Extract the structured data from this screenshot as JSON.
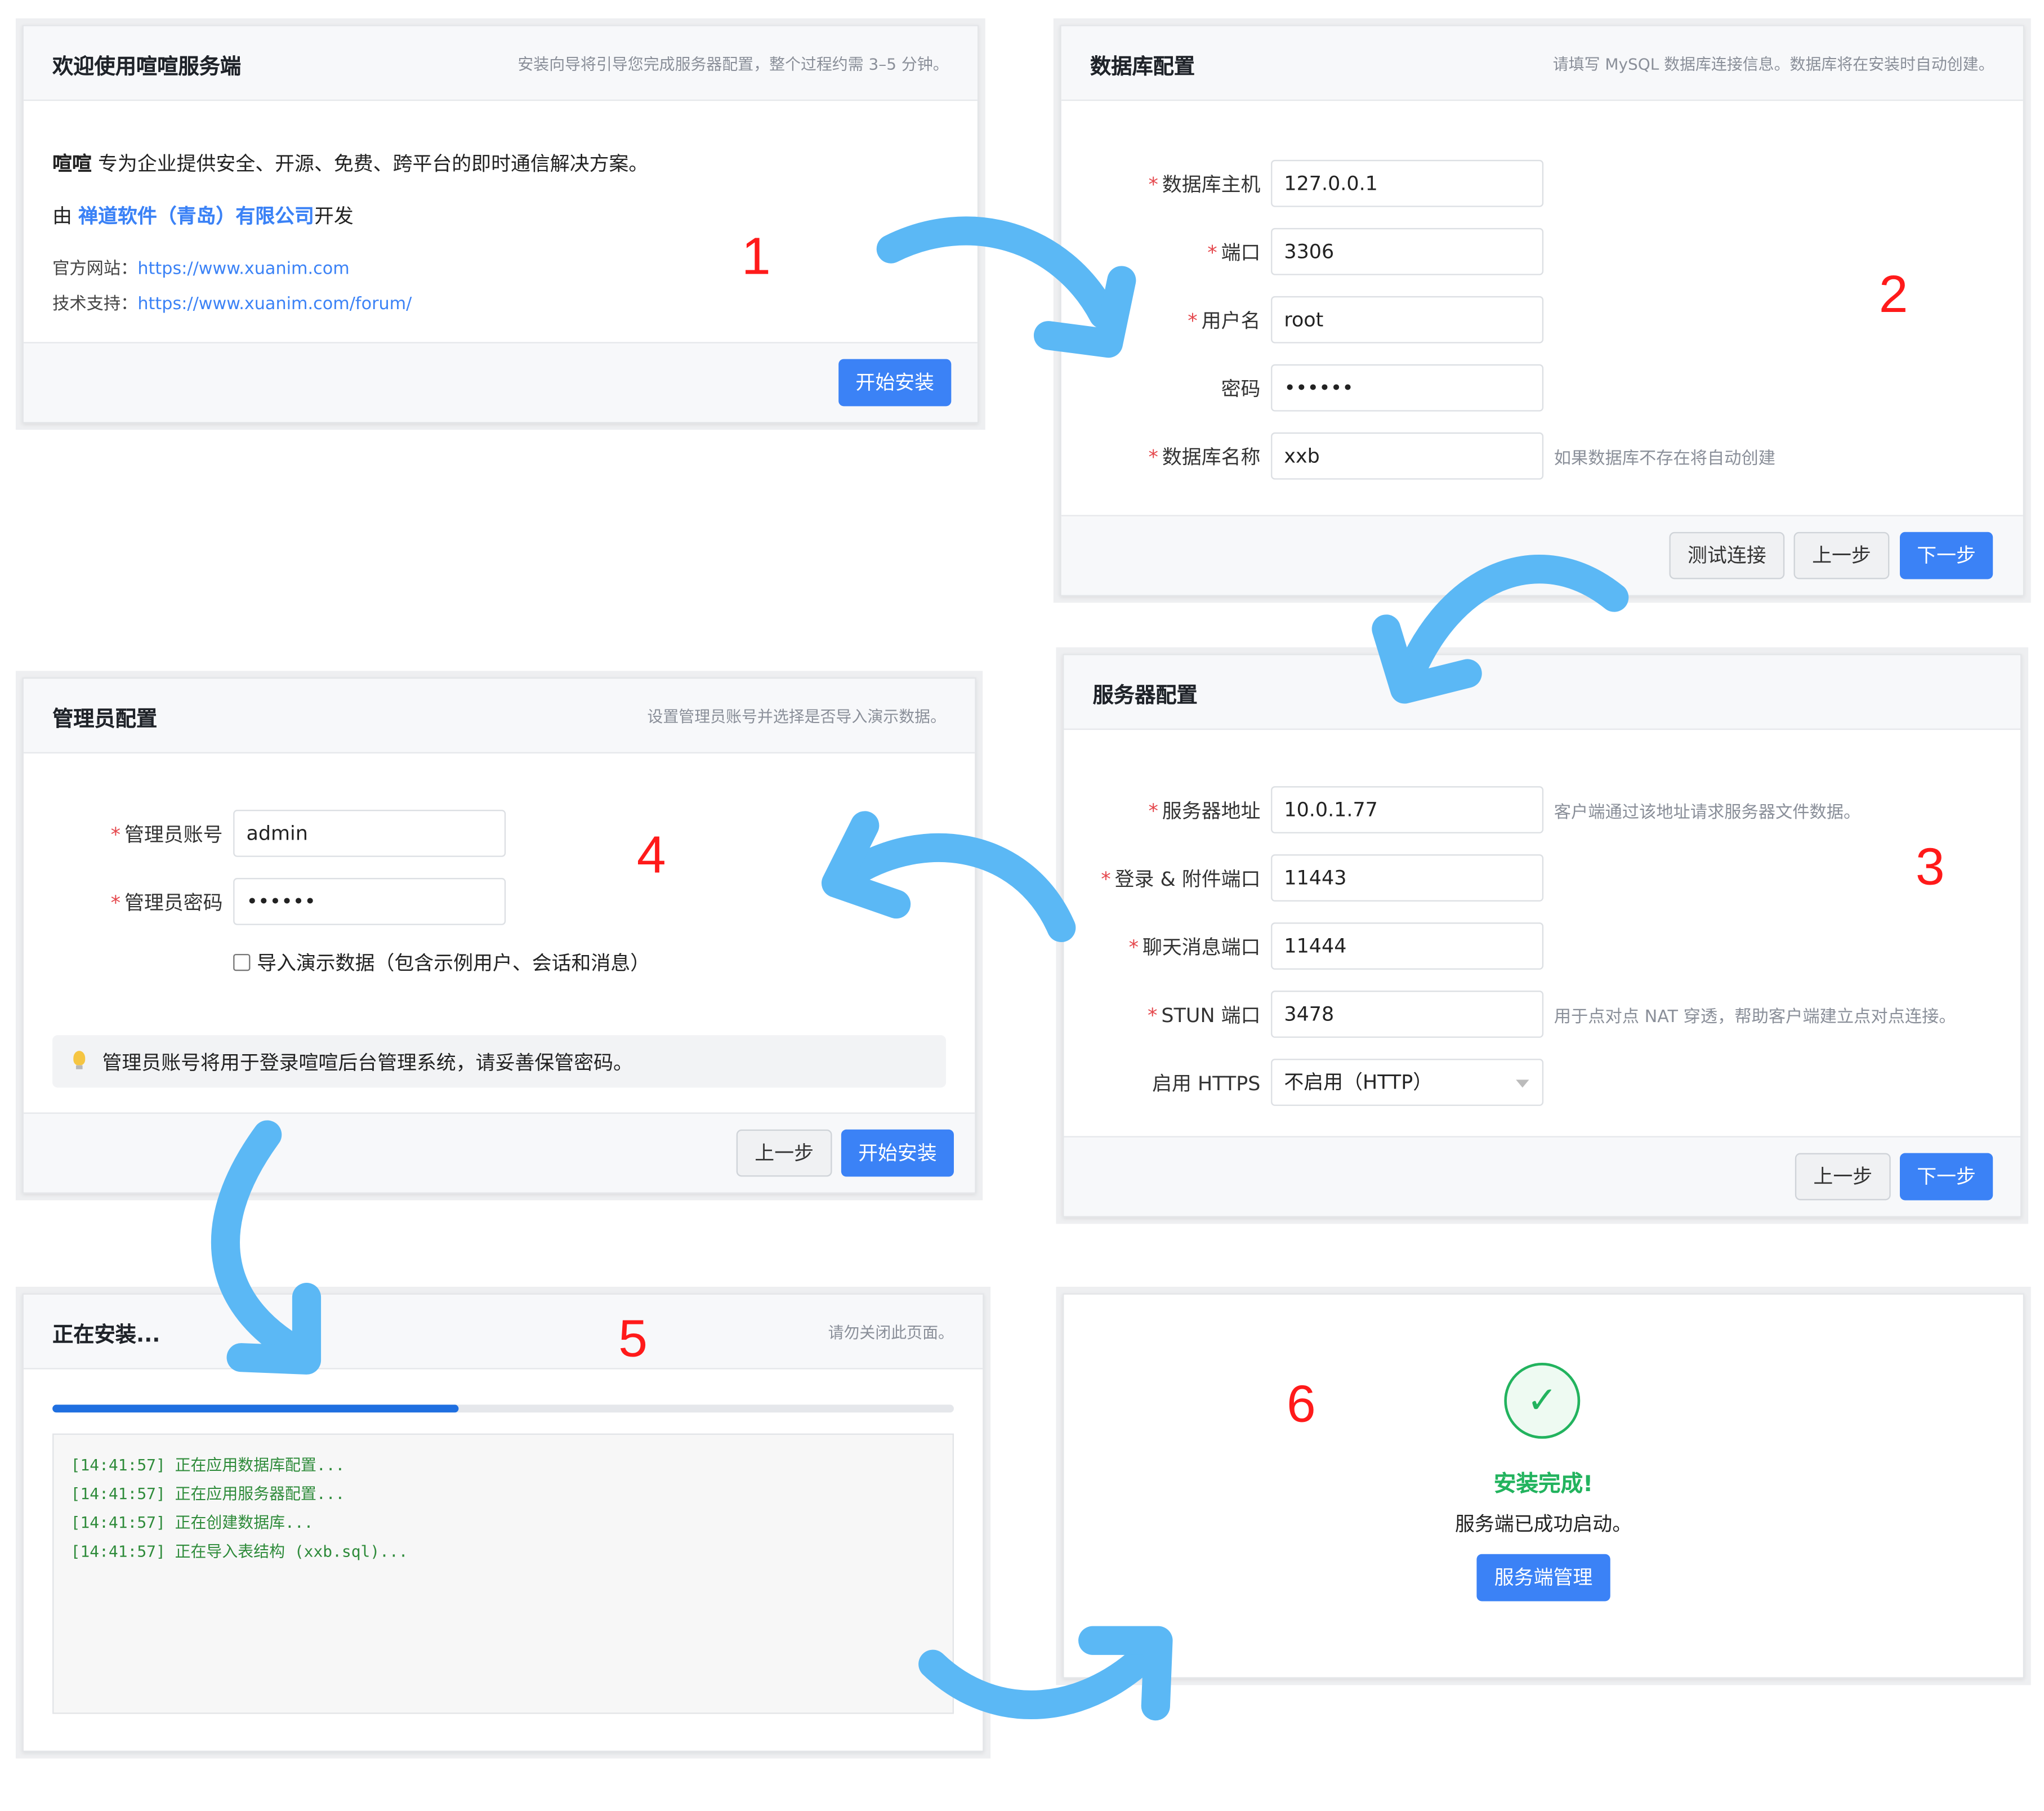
{
  "steps": {
    "welcome": {
      "number": "1",
      "title": "欢迎使用喧喧服务端",
      "desc": "安装向导将引导您完成服务器配置，整个过程约需 3–5 分钟。",
      "intro_strong": "喧喧",
      "intro_rest": " 专为企业提供安全、开源、免费、跨平台的即时通信解决方案。",
      "dev_prefix": "由 ",
      "dev_company": "禅道软件（青岛）有限公司",
      "dev_suffix": "开发",
      "site_label": "官方网站：",
      "site_url": "https://www.xuanim.com",
      "support_label": "技术支持：",
      "support_url": "https://www.xuanim.com/forum/",
      "start_button": "开始安装"
    },
    "database": {
      "number": "2",
      "title": "数据库配置",
      "desc": "请填写 MySQL 数据库连接信息。数据库将在安装时自动创建。",
      "fields": [
        {
          "label": "数据库主机",
          "required": "*",
          "value": "127.0.0.1",
          "hint": ""
        },
        {
          "label": "端口",
          "required": "*",
          "value": "3306",
          "hint": ""
        },
        {
          "label": "用户名",
          "required": "*",
          "value": "root",
          "hint": ""
        },
        {
          "label": "密码",
          "required": "",
          "value": "••••••",
          "hint": ""
        },
        {
          "label": "数据库名称",
          "required": "*",
          "value": "xxb",
          "hint": "如果数据库不存在将自动创建"
        }
      ],
      "test_button": "测试连接",
      "prev_button": "上一步",
      "next_button": "下一步"
    },
    "server": {
      "number": "3",
      "title": "服务器配置",
      "fields": [
        {
          "label": "服务器地址",
          "required": "*",
          "value": "10.0.1.77",
          "hint": "客户端通过该地址请求服务器文件数据。"
        },
        {
          "label": "登录 & 附件端口",
          "required": "*",
          "value": "11443",
          "hint": ""
        },
        {
          "label": "聊天消息端口",
          "required": "*",
          "value": "11444",
          "hint": ""
        },
        {
          "label": "STUN 端口",
          "required": "*",
          "value": "3478",
          "hint": "用于点对点 NAT 穿透，帮助客户端建立点对点连接。"
        }
      ],
      "https_label": "启用 HTTPS",
      "https_selected": "不启用（HTTP）",
      "prev_button": "上一步",
      "next_button": "下一步"
    },
    "admin": {
      "number": "4",
      "title": "管理员配置",
      "desc": "设置管理员账号并选择是否导入演示数据。",
      "fields": [
        {
          "label": "管理员账号",
          "required": "*",
          "value": "admin"
        },
        {
          "label": "管理员密码",
          "required": "*",
          "value": "••••••"
        }
      ],
      "demo_checkbox_label": "导入演示数据（包含示例用户、会话和消息）",
      "demo_checked": false,
      "notice": "管理员账号将用于登录喧喧后台管理系统，请妥善保管密码。",
      "prev_button": "上一步",
      "start_button": "开始安装"
    },
    "installing": {
      "number": "5",
      "title": "正在安装...",
      "desc": "请勿关闭此页面。",
      "progress": 0.45,
      "log": [
        "[14:41:57] 正在应用数据库配置...",
        "[14:41:57] 正在应用服务器配置...",
        "[14:41:57] 正在创建数据库...",
        "[14:41:57] 正在导入表结构 (xxb.sql)..."
      ]
    },
    "done": {
      "number": "6",
      "check_symbol": "✓",
      "title": "安装完成!",
      "message": "服务端已成功启动。",
      "manage_button": "服务端管理"
    }
  },
  "colors": {
    "primary": "#3b82f6",
    "success": "#22b35e",
    "required": "#e5484d",
    "step_number": "#ff1a1a",
    "arrow": "#5bb8f5",
    "log_text": "#2e8b3a"
  }
}
